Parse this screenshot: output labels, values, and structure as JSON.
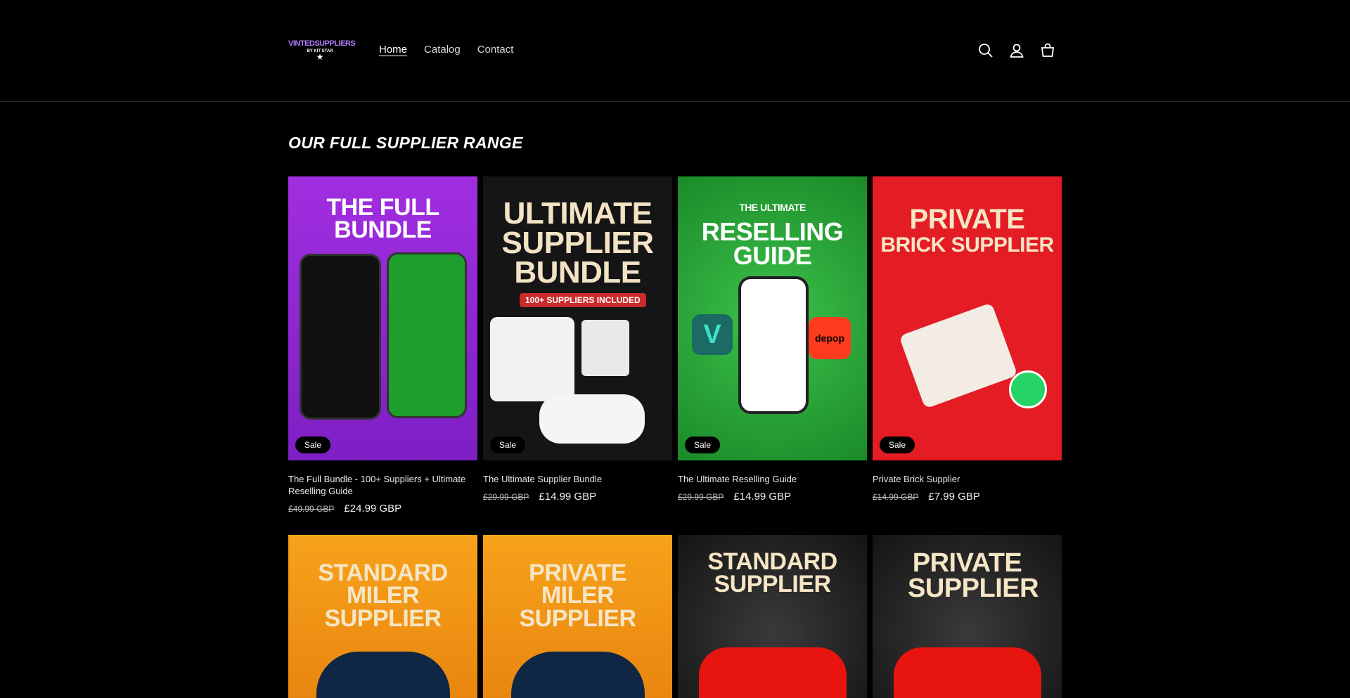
{
  "header": {
    "logo_text": "VINTEDSUPPLIERS",
    "logo_sub": "BY KIT STAR",
    "nav": [
      {
        "label": "Home",
        "active": true
      },
      {
        "label": "Catalog"
      },
      {
        "label": "Contact"
      }
    ],
    "icons": [
      "search-icon",
      "account-icon",
      "cart-icon"
    ]
  },
  "main": {
    "section_title": "OUR FULL SUPPLIER RANGE",
    "products": [
      {
        "title": "The Full Bundle - 100+ Suppliers + Ultimate Reselling Guide",
        "old_price": "£49.99 GBP",
        "price": "£24.99 GBP",
        "badge": "Sale",
        "image_text": "THE FULL BUNDLE",
        "bg": "#9b2cd6"
      },
      {
        "title": "The Ultimate Supplier Bundle",
        "old_price": "£29.99 GBP",
        "price": "£14.99 GBP",
        "badge": "Sale",
        "image_text": "ULTIMATE SUPPLIER BUNDLE",
        "image_sub": "100+ SUPPLIERS INCLUDED",
        "bg": "#151515"
      },
      {
        "title": "The Ultimate Reselling Guide",
        "old_price": "£29.99 GBP",
        "price": "£14.99 GBP",
        "badge": "Sale",
        "image_text": "RESELLING GUIDE",
        "image_pre": "THE ULTIMATE",
        "bg": "#28a83a"
      },
      {
        "title": "Private Brick Supplier",
        "old_price": "£14.99 GBP",
        "price": "£7.99 GBP",
        "badge": "Sale",
        "image_text": "BRICK SUPPLIER",
        "image_pre": "PRIVATE",
        "bg": "#e41c24"
      }
    ],
    "products_row2": [
      {
        "image_text": "STANDARD MILER SUPPLIER",
        "bg": "#f7a21b"
      },
      {
        "image_text": "PRIVATE MILER SUPPLIER",
        "bg": "#f7a21b"
      },
      {
        "image_text": "STANDARD SUPPLIER",
        "bg": "#1b1b1b"
      },
      {
        "image_text": "PRIVATE SUPPLIER",
        "bg": "#1b1b1b"
      }
    ]
  }
}
